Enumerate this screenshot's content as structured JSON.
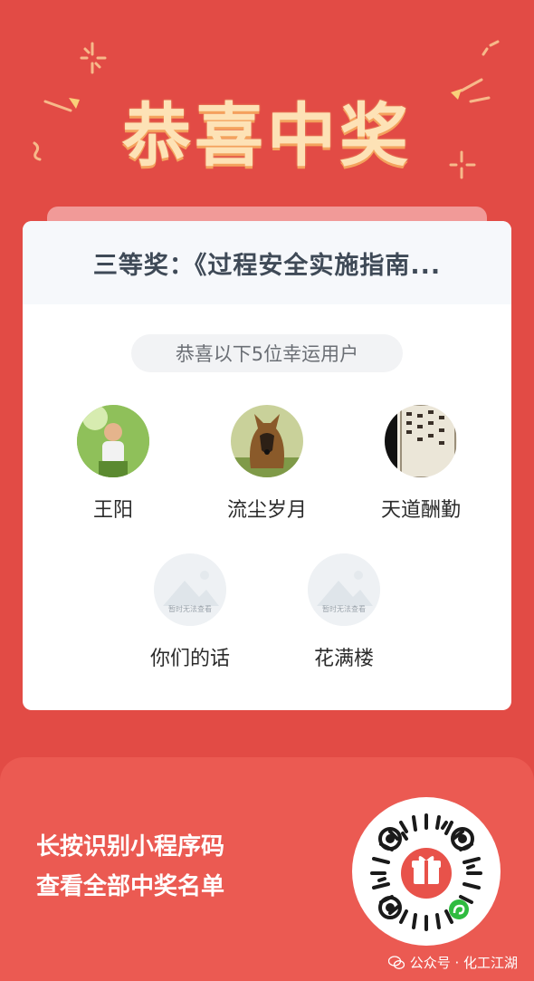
{
  "header": {
    "title": "恭喜中奖"
  },
  "card": {
    "prize_title": "三等奖：《过程安全实施指南...",
    "subtitle": "恭喜以下5位幸运用户",
    "winners": [
      {
        "name": "王阳"
      },
      {
        "name": "流尘岁月"
      },
      {
        "name": "天道酬勤"
      },
      {
        "name": "你们的话",
        "avatar_text": "暂时无法查看"
      },
      {
        "name": "花满楼",
        "avatar_text": "暂时无法查看"
      }
    ]
  },
  "footer": {
    "hint_line1": "长按识别小程序码",
    "hint_line2": "查看全部中奖名单",
    "watermark": "公众号 · 化工江湖"
  },
  "colors": {
    "background": "#e24b45",
    "title": "#fde2b6",
    "footer_panel": "#eb5a52",
    "qr_center": "#e8524a",
    "qr_badge": "#2fbb3f"
  }
}
